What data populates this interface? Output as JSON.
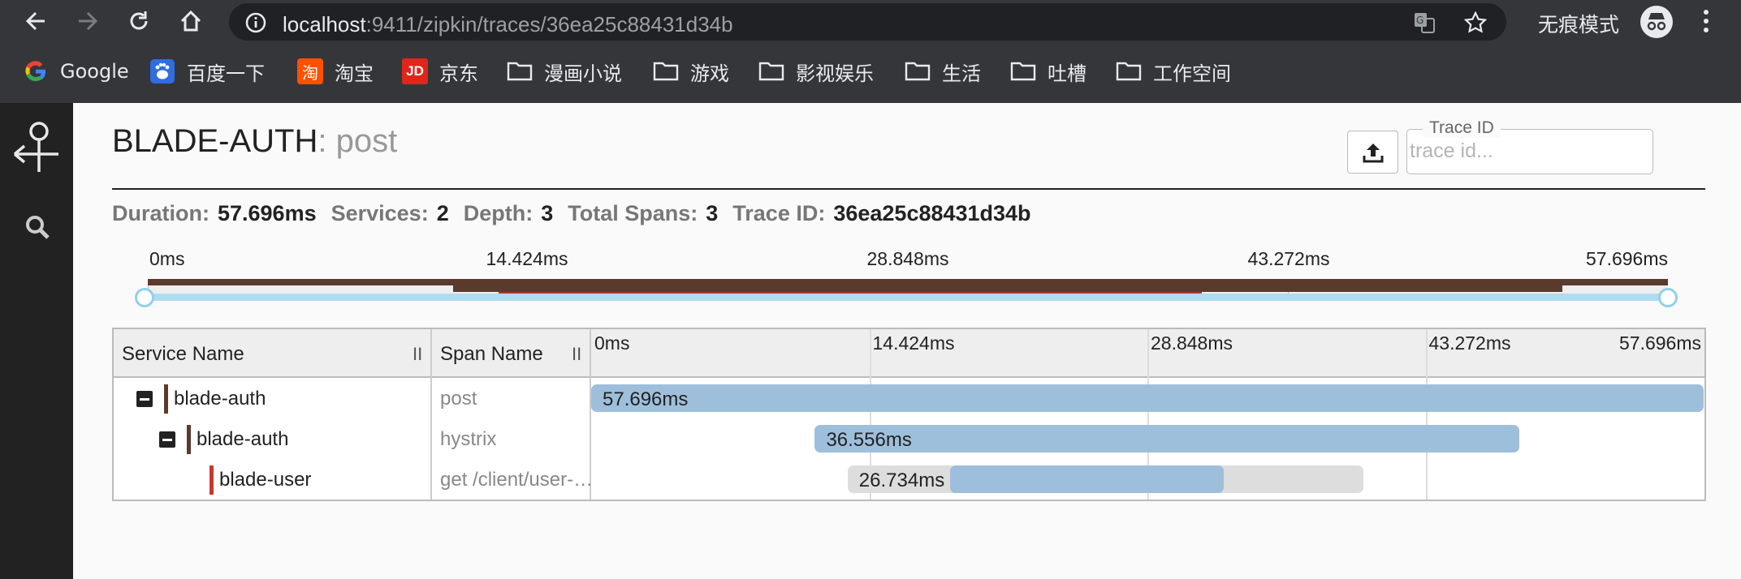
{
  "browser": {
    "url_host": "localhost",
    "url_rest": ":9411/zipkin/traces/36ea25c88431d34b",
    "incognito_label": "无痕模式",
    "bookmarks": [
      {
        "label": "Google",
        "icon": "google-icon"
      },
      {
        "label": "百度一下",
        "icon": "baidu-icon"
      },
      {
        "label": "淘宝",
        "icon": "taobao-icon"
      },
      {
        "label": "京东",
        "icon": "jd-icon"
      },
      {
        "label": "漫画小说",
        "icon": "folder-icon"
      },
      {
        "label": "游戏",
        "icon": "folder-icon"
      },
      {
        "label": "影视娱乐",
        "icon": "folder-icon"
      },
      {
        "label": "生活",
        "icon": "folder-icon"
      },
      {
        "label": "吐槽",
        "icon": "folder-icon"
      },
      {
        "label": "工作空间",
        "icon": "folder-icon"
      }
    ],
    "taobao_glyph": "淘",
    "jd_glyph": "JD"
  },
  "page": {
    "service": "BLADE-AUTH",
    "span": ": post",
    "trace_id_legend": "Trace ID",
    "trace_id_placeholder": "trace id..."
  },
  "summary": {
    "duration_label": "Duration:",
    "duration": "57.696ms",
    "services_label": "Services:",
    "services": "2",
    "depth_label": "Depth:",
    "depth": "3",
    "spans_label": "Total Spans:",
    "spans": "3",
    "traceid_label": "Trace ID:",
    "traceid": "36ea25c88431d34b"
  },
  "timeline": {
    "total_ms": 57.696,
    "ticks": [
      "0ms",
      "14.424ms",
      "28.848ms",
      "43.272ms",
      "57.696ms"
    ],
    "col_service": "Service Name",
    "col_span": "Span Name",
    "resize_glyph": "II",
    "rows": [
      {
        "service": "blade-auth",
        "span": "post",
        "start_ms": 0,
        "duration_ms": 57.696,
        "duration_label": "57.696ms",
        "color": "#5b3a2e",
        "depth": 0,
        "has_toggle": true,
        "error": false
      },
      {
        "service": "blade-auth",
        "span": "hystrix",
        "start_ms": 11.6,
        "duration_ms": 36.556,
        "duration_label": "36.556ms",
        "color": "#5b3a2e",
        "depth": 1,
        "has_toggle": true,
        "error": false
      },
      {
        "service": "blade-user",
        "span": "get /client/user-info",
        "start_ms": 13.3,
        "duration_ms": 26.734,
        "duration_label": "26.734ms",
        "color": "#c23a2e",
        "depth": 2,
        "has_toggle": false,
        "error": true,
        "inner_start_ms": 18.6,
        "inner_duration_ms": 14.2
      }
    ]
  },
  "colors": {
    "chrome_bg": "#35363a",
    "sidenav_bg": "#222222",
    "bar": "#9ebfdc",
    "minimap_brown": "#5b3a2e",
    "minimap_red": "#b03a2e",
    "handle_track": "#aedcf2"
  }
}
